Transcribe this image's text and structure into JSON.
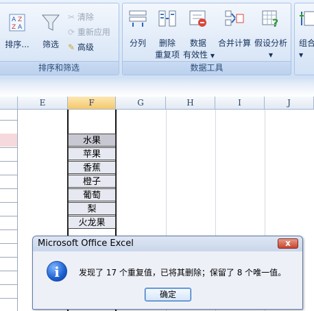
{
  "ribbon": {
    "sort_filter": {
      "sort_label": "排序...",
      "filter_label": "筛选",
      "clear_label": "清除",
      "reapply_label": "重新应用",
      "advanced_label": "高级",
      "group_title": "排序和筛选"
    },
    "data_tools": {
      "split_label": "分列",
      "remove_dup_line1": "删除",
      "remove_dup_line2": "重复项",
      "validation_line1": "数据",
      "validation_line2": "有效性",
      "consolidate_label": "合并计算",
      "whatif_label": "假设分析",
      "group_title": "数据工具"
    },
    "outline": {
      "group_label": "组合"
    }
  },
  "sheet": {
    "columns": [
      "E",
      "F",
      "G",
      "H",
      "I",
      "J"
    ],
    "selected_column": "F",
    "cells": [
      "水果",
      "苹果",
      "香蕉",
      "橙子",
      "葡萄",
      "梨",
      "火龙果"
    ]
  },
  "dialog": {
    "title": "Microsoft Office Excel",
    "close_label": "x",
    "message": "发现了 17 个重复值，已将其删除；保留了 8 个唯一值。",
    "ok_label": "确定"
  }
}
